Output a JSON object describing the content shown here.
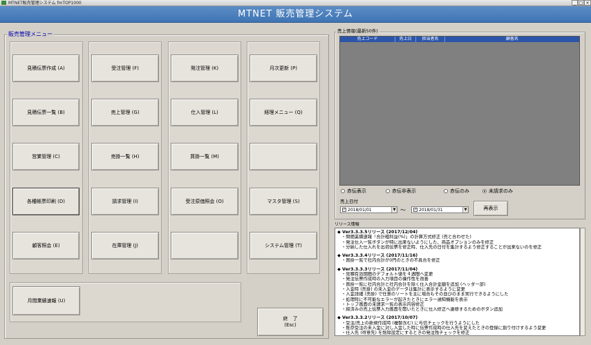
{
  "os_window": {
    "title": "MTNET販売管理システム  fmTOP1000",
    "minimize": "_",
    "maximize": "□",
    "close": "×"
  },
  "header": {
    "title": "MTNET  販売管理システム"
  },
  "menu": {
    "legend": "販売管理メニュー",
    "columns": [
      [
        "見積伝票作成 (A)",
        "見積伝票一覧 (B)",
        "営業管理 (C)",
        "各種帳票印刷 (D)",
        "顧客照会 (E)"
      ],
      [
        "受注管理 (F)",
        "売上管理 (G)",
        "売掛一覧 (H)",
        "請求管理 (I)",
        "在庫管理 (J)"
      ],
      [
        "発注管理 (K)",
        "仕入管理 (L)",
        "買掛一覧 (M)",
        "受注原価照会 (O)",
        ""
      ],
      [
        "月次更新 (P)",
        "経理メニュー (Q)",
        "",
        "マスタ管理 (S)",
        "システム管理 (T)"
      ]
    ],
    "monthly_report": "月間業績速報 (U)",
    "exit": {
      "line1": "終　了",
      "line2": "(Esc)"
    }
  },
  "sales": {
    "legend": "売上情報(最新50件)",
    "columns": [
      "売上コード",
      "売上日",
      "担当者名",
      "顧客名"
    ],
    "filters": [
      {
        "label": "赤伝表示",
        "selected": false
      },
      {
        "label": "赤伝非表示",
        "selected": false
      },
      {
        "label": "赤伝のみ",
        "selected": false
      },
      {
        "label": "未請求のみ",
        "selected": true
      }
    ],
    "date_label": "売上日付",
    "date_from": "2018/01/01",
    "date_to": "2018/01/31",
    "tilde": "～",
    "redisplay": "再表示"
  },
  "release": {
    "legend": "リリース情報",
    "sections": [
      {
        "version": "Ver3.3.3.5リリース (2017/12/04)",
        "items": [
          "・問間業績速報「合計粗利益(%)」の計算方式修正 (売と合わせた)",
          "・発注仕入一覧ボタンが特に出来ないようにした、商品オプションのみを修正",
          "・分納した仕入れを出荷伝票を修正時、仕入先の日付を集計するよう修正することが出来ないのを修正"
        ]
      },
      {
        "version": "Ver3.3.3.4リリース (2017/11/16)",
        "items": [
          "・買掛一覧で社内合計が0円のときの不具合を修正"
        ]
      },
      {
        "version": "Ver3.3.3.3リリース (2017/11/04)",
        "items": [
          "・見積有効期間のデフォルト値を４週間へ変更",
          "・発注伝票作成時の入力項目の操作性を改善",
          "・買掛一覧に社内合計と社内合計を除く仕入合計金額を追加 (ヘッダー部)",
          "・入金時 (売掛) の未入金のデータは集計に表示するように変更",
          "・入金詳細 (売掛) で任意のソートを主に場合もその並びのまま実行できるようにした",
          "・処理時に不可能なエラーが起きたときにエラー通知機能を表示",
          "・トップ画面の未請求一覧の表示内容修正",
          "・締済みの売上伝票入力画面を開いたときに仕入修正へ遷移するためのボタン追加"
        ]
      },
      {
        "version": "Ver3.3.3.2リリース (2017/10/07)",
        "items": [
          "・受注/売上の新規作成時 (複製含む) に与信チェックを行うようにした",
          "・既存受注の未入金に対し入金した時に伝票作成時の仕入先を変えたときの登録に割り付けするよう変更",
          "・仕入先 (得意先) を削除設定にするときの発注残チェックを修正"
        ]
      }
    ]
  },
  "colors": {
    "header": "#4a7dbb",
    "grid_header": "#2c55aa",
    "grid_body": "#808080",
    "background": "#d4d0c8"
  }
}
